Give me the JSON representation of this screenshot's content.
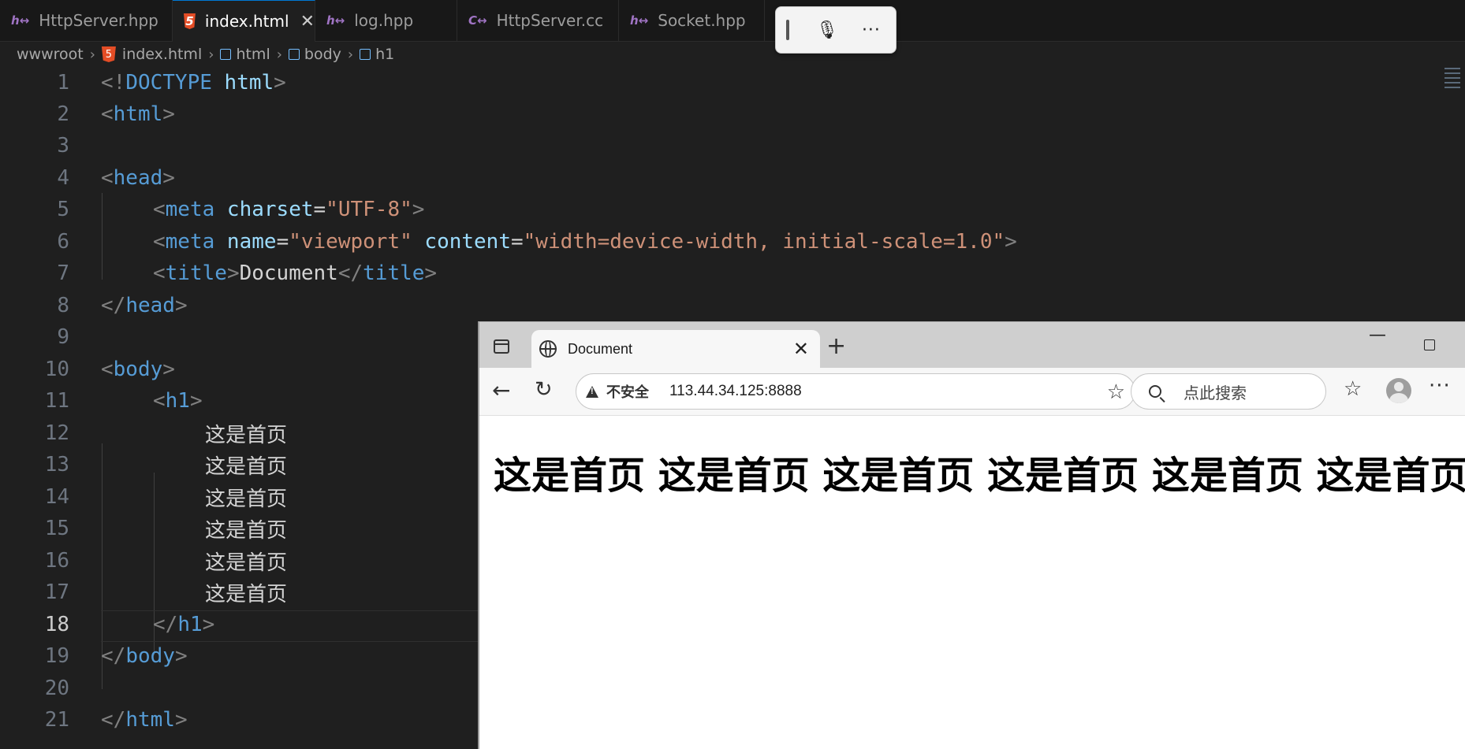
{
  "editor": {
    "tabs": [
      {
        "label": "HttpServer.hpp",
        "icon": "h-header-icon",
        "active": false
      },
      {
        "label": "index.html",
        "icon": "html5-icon",
        "active": true
      },
      {
        "label": "log.hpp",
        "icon": "h-header-icon",
        "active": false
      },
      {
        "label": "HttpServer.cc",
        "icon": "cpp-icon",
        "active": false
      },
      {
        "label": "Socket.hpp",
        "icon": "h-header-icon",
        "active": false
      }
    ],
    "close_glyph": "✕",
    "breadcrumb": [
      "wwwroot",
      "index.html",
      "html",
      "body",
      "h1"
    ],
    "current_line": 18,
    "line_numbers": [
      "1",
      "2",
      "3",
      "4",
      "5",
      "6",
      "7",
      "8",
      "9",
      "10",
      "11",
      "12",
      "13",
      "14",
      "15",
      "16",
      "17",
      "18",
      "19",
      "20",
      "21"
    ],
    "code": {
      "l1": {
        "a": "<!",
        "b": "DOCTYPE",
        "c": " html",
        "d": ">"
      },
      "l2": {
        "a": "<",
        "b": "html",
        "c": ">"
      },
      "l4": {
        "a": "<",
        "b": "head",
        "c": ">"
      },
      "l5": {
        "a": "<",
        "b": "meta",
        "c": " charset",
        "d": "=",
        "e": "\"UTF-8\"",
        "f": ">"
      },
      "l6": {
        "a": "<",
        "b": "meta",
        "c": " name",
        "d": "=",
        "e": "\"viewport\"",
        "f": " content",
        "g": "=",
        "h": "\"width=device-width, initial-scale=1.0\"",
        "i": ">"
      },
      "l7": {
        "a": "<",
        "b": "title",
        "c": ">",
        "d": "Document",
        "e": "</",
        "f": "title",
        "g": ">"
      },
      "l8": {
        "a": "</",
        "b": "head",
        "c": ">"
      },
      "l10": {
        "a": "<",
        "b": "body",
        "c": ">"
      },
      "l11": {
        "a": "<",
        "b": "h1",
        "c": ">"
      },
      "text_lines": [
        "这是首页",
        "这是首页",
        "这是首页",
        "这是首页",
        "这是首页",
        "这是首页"
      ],
      "l18": {
        "a": "</",
        "b": "h1",
        "c": ">"
      },
      "l19": {
        "a": "</",
        "b": "body",
        "c": ">"
      },
      "l21": {
        "a": "</",
        "b": "html",
        "c": ">"
      }
    }
  },
  "voice_toolbar": {
    "mic_icon": "microphone-icon",
    "more_glyph": "···"
  },
  "browser": {
    "tab_title": "Document",
    "tab_close": "✕",
    "new_tab": "+",
    "minimize": "—",
    "insecure_label": "不安全",
    "url": "113.44.34.125:8888",
    "search_placeholder": "点此搜索",
    "more_glyph": "···",
    "page_h1": "这是首页 这是首页 这是首页 这是首页 这是首页 这是首页"
  },
  "colors": {
    "editor_bg": "#1f1f1f",
    "tag": "#569cd6",
    "attr": "#9cdcfe",
    "string": "#ce9178",
    "punct": "#808080"
  }
}
